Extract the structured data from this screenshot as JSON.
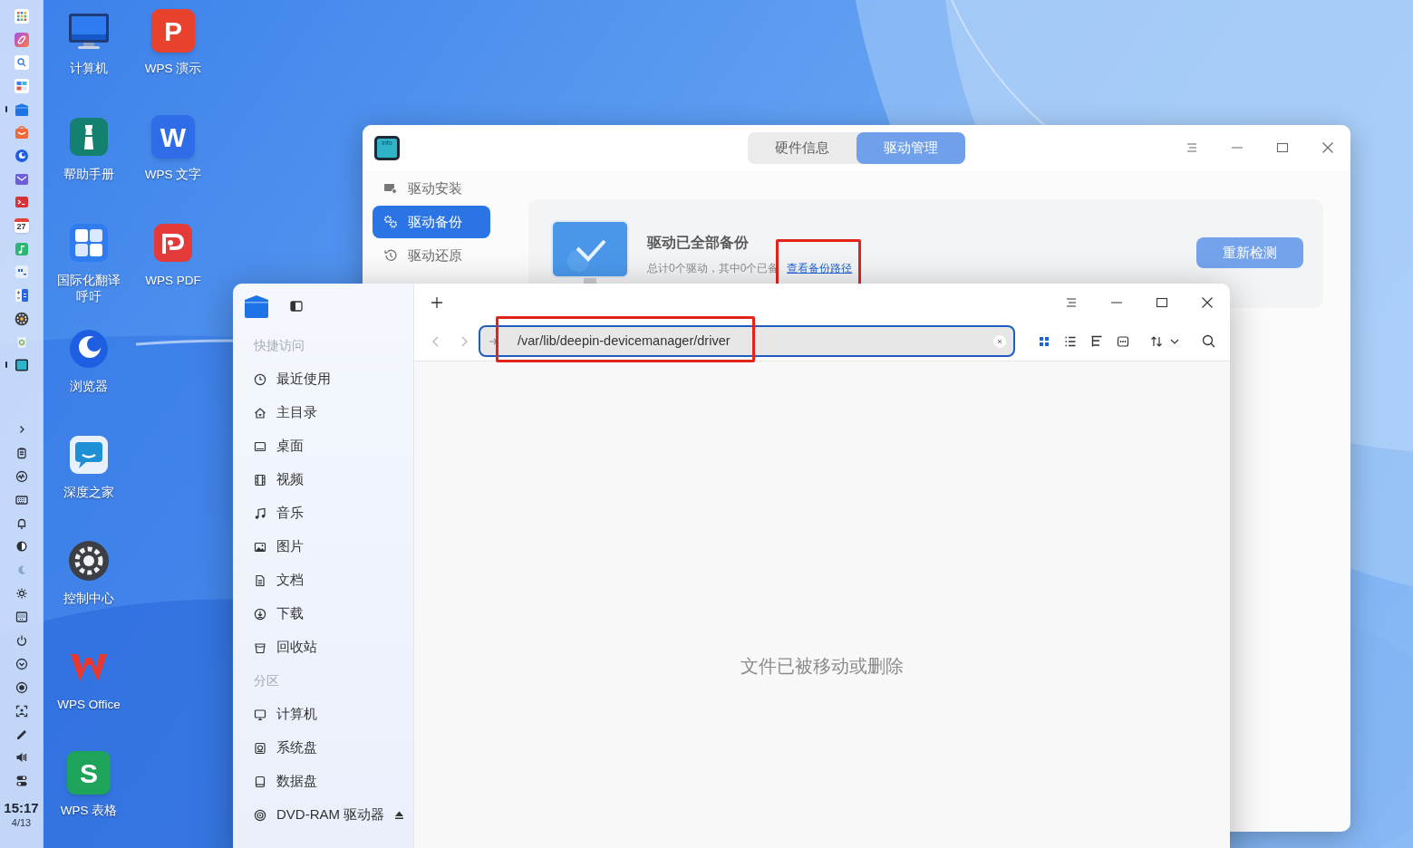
{
  "dock": {
    "apps": [
      {
        "running": false
      },
      {
        "running": false
      },
      {
        "running": false
      },
      {
        "running": false
      },
      {
        "running": true
      },
      {
        "running": false
      },
      {
        "running": false
      },
      {
        "running": false
      },
      {
        "running": false
      },
      {
        "running": false,
        "badge": "27"
      },
      {
        "running": false
      },
      {
        "running": false
      },
      {
        "running": false
      },
      {
        "running": false
      },
      {
        "running": false
      },
      {
        "running": true
      }
    ],
    "clock": {
      "time": "15:17",
      "date": "4/13"
    }
  },
  "desktop": {
    "columns": [
      [
        {
          "kind": "computer",
          "label": "计算机"
        },
        {
          "kind": "help",
          "label": "帮助手册"
        },
        {
          "kind": "translate",
          "label": "国际化翻译呼吁"
        },
        {
          "kind": "browser",
          "label": "浏览器"
        },
        {
          "kind": "community",
          "label": "深度之家"
        },
        {
          "kind": "settings",
          "label": "控制中心"
        },
        {
          "kind": "wps-office",
          "label": "WPS Office"
        },
        {
          "kind": "letter",
          "glyph": "S",
          "color": "#1ea35b",
          "label": "WPS 表格"
        }
      ],
      [
        {
          "kind": "letter",
          "glyph": "P",
          "color": "#e8412c",
          "label": "WPS 演示"
        },
        {
          "kind": "letter",
          "glyph": "W",
          "color": "#2f6de8",
          "label": "WPS 文字"
        },
        {
          "kind": "wps-pdf",
          "label": "WPS PDF"
        }
      ]
    ]
  },
  "device_manager": {
    "app_icon_text": "info",
    "tabs": [
      {
        "label": "硬件信息",
        "selected": false
      },
      {
        "label": "驱动管理",
        "selected": true
      }
    ],
    "sidebar": {
      "items": [
        {
          "label": "驱动安装",
          "selected": false
        },
        {
          "label": "驱动备份",
          "selected": true
        },
        {
          "label": "驱动还原",
          "selected": false
        }
      ]
    },
    "status": {
      "title": "驱动已全部备份",
      "detail": "总计0个驱动，其中0个已备",
      "link": {
        "label": "查看备份路径",
        "highlighted": true
      }
    },
    "button": "重新检测"
  },
  "file_manager": {
    "sidebar": {
      "groups": [
        {
          "title": "快捷访问",
          "items": [
            {
              "label": "最近使用"
            },
            {
              "label": "主目录"
            },
            {
              "label": "桌面"
            },
            {
              "label": "视频"
            },
            {
              "label": "音乐"
            },
            {
              "label": "图片"
            },
            {
              "label": "文档"
            },
            {
              "label": "下载"
            },
            {
              "label": "回收站"
            }
          ]
        },
        {
          "title": "分区",
          "items": [
            {
              "label": "计算机"
            },
            {
              "label": "系统盘"
            },
            {
              "label": "数据盘"
            },
            {
              "label": "DVD-RAM 驱动器",
              "ejectable": true
            }
          ]
        }
      ]
    },
    "address": {
      "value": "/var/lib/deepin-devicemanager/driver",
      "highlighted": true
    },
    "view_modes": [
      {
        "selected": true
      },
      {
        "selected": false
      },
      {
        "selected": false
      },
      {
        "selected": false
      }
    ],
    "message": "文件已被移动或删除"
  }
}
